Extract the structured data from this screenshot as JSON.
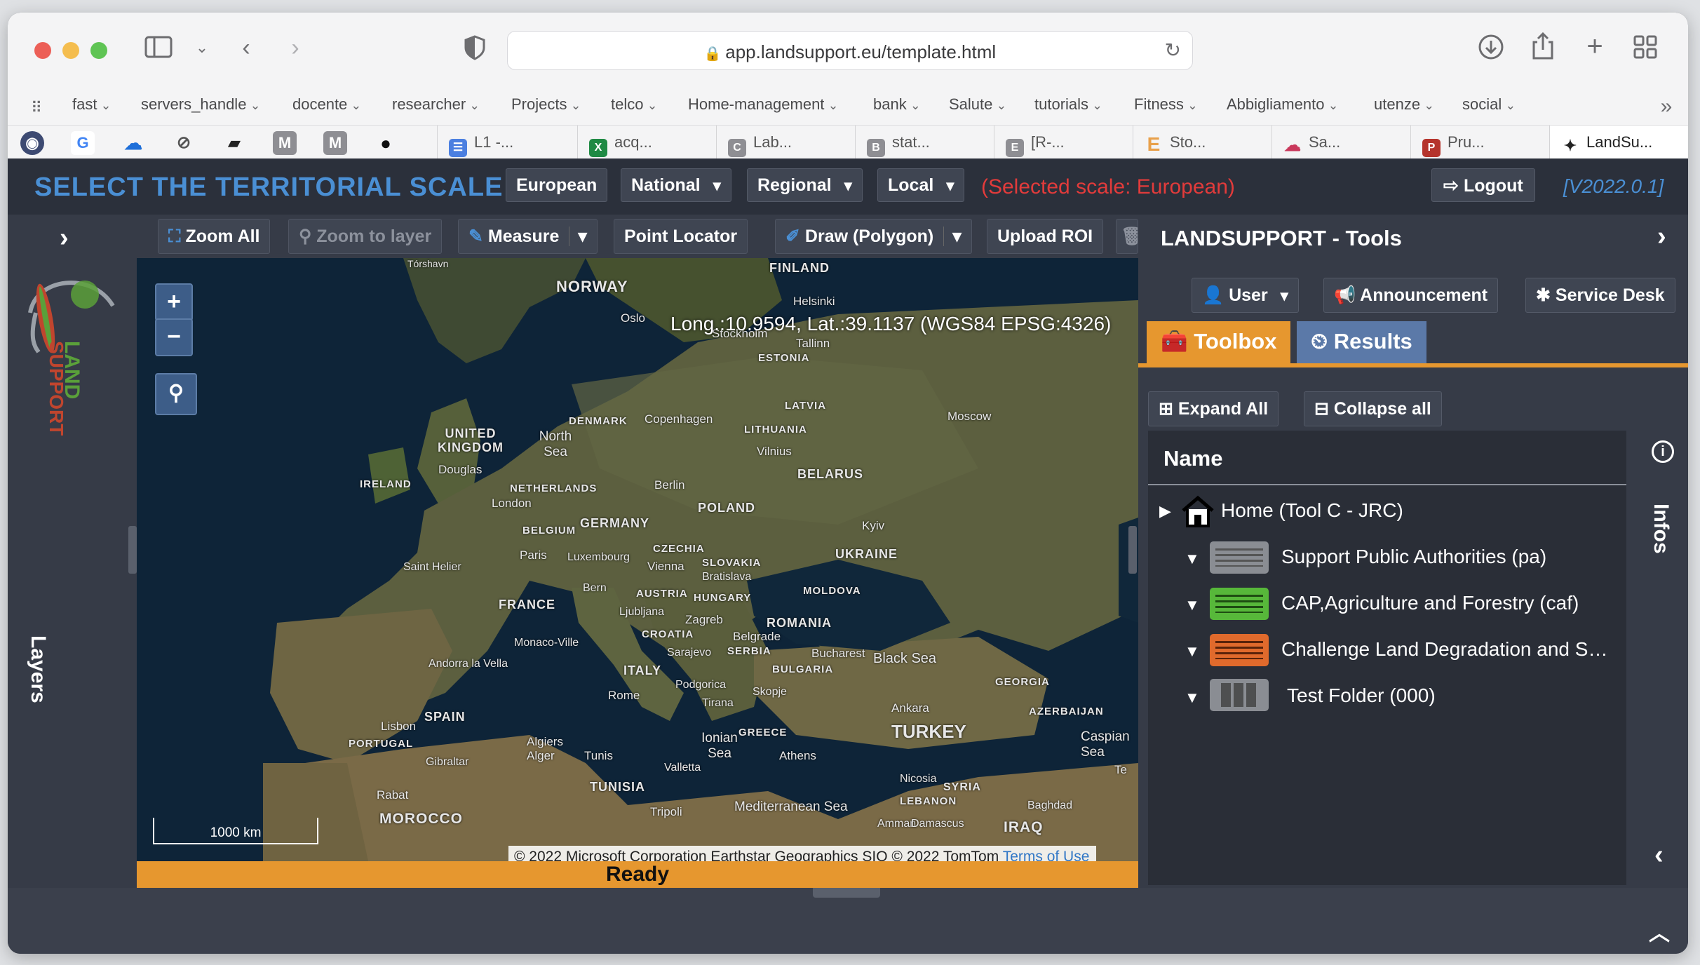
{
  "browser": {
    "url": "app.landsupport.eu/template.html",
    "bookmarks": [
      "fast",
      "servers_handle",
      "docente",
      "researcher",
      "Projects",
      "telco",
      "Home-management",
      "bank",
      "Salute",
      "tutorials",
      "Fitness",
      "Abbigliamento",
      "utenze",
      "social"
    ],
    "pinned_tabs": [
      "M",
      "M"
    ],
    "tabs": [
      {
        "label": "L1 -...",
        "color": "#4b7fe0",
        "glyph": "☰"
      },
      {
        "label": "acq...",
        "color": "#1f8a44",
        "glyph": "X"
      },
      {
        "label": "Lab...",
        "color": "#8e8e93",
        "glyph": "C"
      },
      {
        "label": "stat...",
        "color": "#8e8e93",
        "glyph": "B"
      },
      {
        "label": "[R-...",
        "color": "#8e8e93",
        "glyph": "E"
      },
      {
        "label": "Sto...",
        "color": "#e8a04a",
        "glyph": "E"
      },
      {
        "label": "Sa...",
        "color": "#c9375b",
        "glyph": "☁"
      },
      {
        "label": "Pru...",
        "color": "#b5342c",
        "glyph": "P"
      },
      {
        "label": "LandSu...",
        "color": "#222222",
        "glyph": "✦"
      }
    ]
  },
  "header": {
    "scale_title": "SELECT THE TERRITORIAL SCALE:",
    "scale_buttons": [
      "European",
      "National",
      "Regional",
      "Local"
    ],
    "selected_scale": "(Selected scale: European)",
    "logout": "Logout",
    "version": "[V2022.0.1]"
  },
  "layers": {
    "label": "Layers",
    "logo_text": "LAND SUPPORT"
  },
  "map_toolbar": {
    "zoom_all": "Zoom All",
    "zoom_to_layer": "Zoom to layer",
    "measure": "Measure",
    "point_locator": "Point Locator",
    "draw_polygon": "Draw (Polygon)",
    "upload_roi": "Upload ROI"
  },
  "map": {
    "coords": "Long.:10.9594, Lat.:39.1137 (WGS84 EPSG:4326)",
    "zoom_in": "+",
    "zoom_out": "−",
    "scale_label": "1000 km",
    "attribution": "© 2022 Microsoft Corporation Earthstar Geographics SIO © 2022 TomTom",
    "terms": "Terms of Use",
    "status": "Ready",
    "labels": {
      "finland": "FINLAND",
      "norway": "NORWAY",
      "oslo": "Oslo",
      "helsinki": "Helsinki",
      "stockholm": "Stockholm",
      "tallinn": "Tallinn",
      "estonia": "ESTONIA",
      "latvia": "LATVIA",
      "moscow": "Moscow",
      "denmark": "DENMARK",
      "copenhagen": "Copenhagen",
      "lithuania": "LITHUANIA",
      "vilnius": "Vilnius",
      "uk": "UNITED KINGDOM",
      "north_sea": "North Sea",
      "douglas": "Douglas",
      "ireland": "IRELAND",
      "netherlands": "NETHERLANDS",
      "berlin": "Berlin",
      "belarus": "BELARUS",
      "london": "London",
      "poland": "POLAND",
      "germany": "GERMANY",
      "belgium": "BELGIUM",
      "kyiv": "Kyiv",
      "paris": "Paris",
      "luxembourg": "Luxembourg",
      "czechia": "CZECHIA",
      "ukraine": "UKRAINE",
      "vienna": "Vienna",
      "slovakia": "SLOVAKIA",
      "bratislava": "Bratislava",
      "saint_helier": "Saint Helier",
      "bern": "Bern",
      "austria": "AUSTRIA",
      "hungary": "HUNGARY",
      "moldova": "MOLDOVA",
      "france": "FRANCE",
      "ljubljana": "Ljubljana",
      "zagreb": "Zagreb",
      "croatia": "CROATIA",
      "romania": "ROMANIA",
      "belgrade": "Belgrade",
      "monaco": "Monaco-Ville",
      "sarajevo": "Sarajevo",
      "serbia": "SERBIA",
      "bucharest": "Bucharest",
      "black_sea": "Black Sea",
      "andorra": "Andorra la Vella",
      "italy": "ITALY",
      "bulgaria": "BULGARIA",
      "podgorica": "Podgorica",
      "skopje": "Skopje",
      "georgia": "GEORGIA",
      "rome": "Rome",
      "tirana": "Tirana",
      "ankara": "Ankara",
      "azerbaijan": "AZERBAIJAN",
      "spain": "SPAIN",
      "lisbon": "Lisbon",
      "greece": "GREECE",
      "turkey": "TURKEY",
      "caspian": "Caspian Sea",
      "portugal": "PORTUGAL",
      "algiers": "Algiers Alger",
      "ionian": "Ionian Sea",
      "gibraltar": "Gibraltar",
      "tunis": "Tunis",
      "athens": "Athens",
      "valletta": "Valletta",
      "tunisia": "TUNISIA",
      "nicosia": "Nicosia",
      "syria": "SYRIA",
      "rabat": "Rabat",
      "tripoli": "Tripoli",
      "med_sea": "Mediterranean Sea",
      "lebanon": "LEBANON",
      "baghdad": "Baghdad",
      "morocco": "MOROCCO",
      "amman": "Amman",
      "damascus": "Damascus",
      "iraq": "IRAQ",
      "torshavn": "Tórshavn",
      "te": "Te"
    }
  },
  "tools": {
    "title": "LANDSUPPORT - Tools",
    "user": "User",
    "announcement": "Announcement",
    "service_desk": "Service Desk",
    "tab_toolbox": "Toolbox",
    "tab_results": "Results",
    "expand_all": "Expand All",
    "collapse_all": "Collapse all",
    "tree_header": "Name",
    "tree_items": [
      {
        "label": "Home (Tool C - JRC)"
      },
      {
        "label": "Support Public Authorities (pa)",
        "folder_color": "#8a8d93"
      },
      {
        "label": "CAP,Agriculture and Forestry (caf)",
        "folder_color": "#57b83a"
      },
      {
        "label": "Challenge Land Degradation and S…",
        "folder_color": "#e06a2c"
      },
      {
        "label": "Test Folder (000)",
        "folder_color": "#8a8d93"
      }
    ],
    "infos": "Infos"
  },
  "colors": {
    "accent_orange": "#e6972f",
    "title_blue": "#4a8fd4",
    "selected_red": "#e23b3b",
    "panel_bg": "#363b47"
  }
}
